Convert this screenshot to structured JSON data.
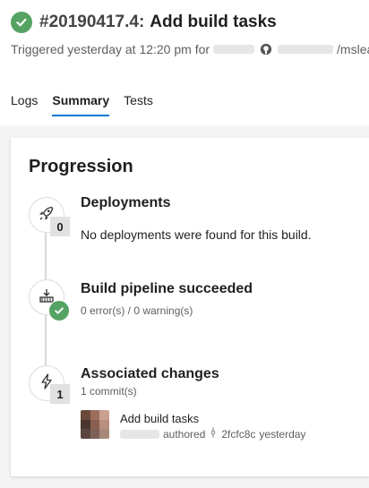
{
  "build": {
    "number": "#20190417.4:",
    "title": "Add build tasks",
    "status_color": "#55a362",
    "status_icon": "check-circle-icon",
    "triggered_text": "Triggered yesterday at 12:20 pm for",
    "repo_suffix": "/mslea"
  },
  "tabs": [
    {
      "label": "Logs",
      "active": false
    },
    {
      "label": "Summary",
      "active": true
    },
    {
      "label": "Tests",
      "active": false
    }
  ],
  "accent_color": "#0078d4",
  "progression": {
    "title": "Progression",
    "deployments": {
      "icon": "rocket-icon",
      "count": "0",
      "title": "Deployments",
      "text": "No deployments were found for this build."
    },
    "pipeline": {
      "icon": "pipeline-icon",
      "title": "Build pipeline succeeded",
      "text": "0 error(s) / 0 warning(s)"
    },
    "changes": {
      "icon": "lightning-icon",
      "count": "1",
      "title": "Associated changes",
      "text": "1 commit(s)",
      "commit": {
        "message": "Add build tasks",
        "authored": "authored",
        "hash": "2fcfc8c",
        "when": "yesterday"
      }
    }
  }
}
